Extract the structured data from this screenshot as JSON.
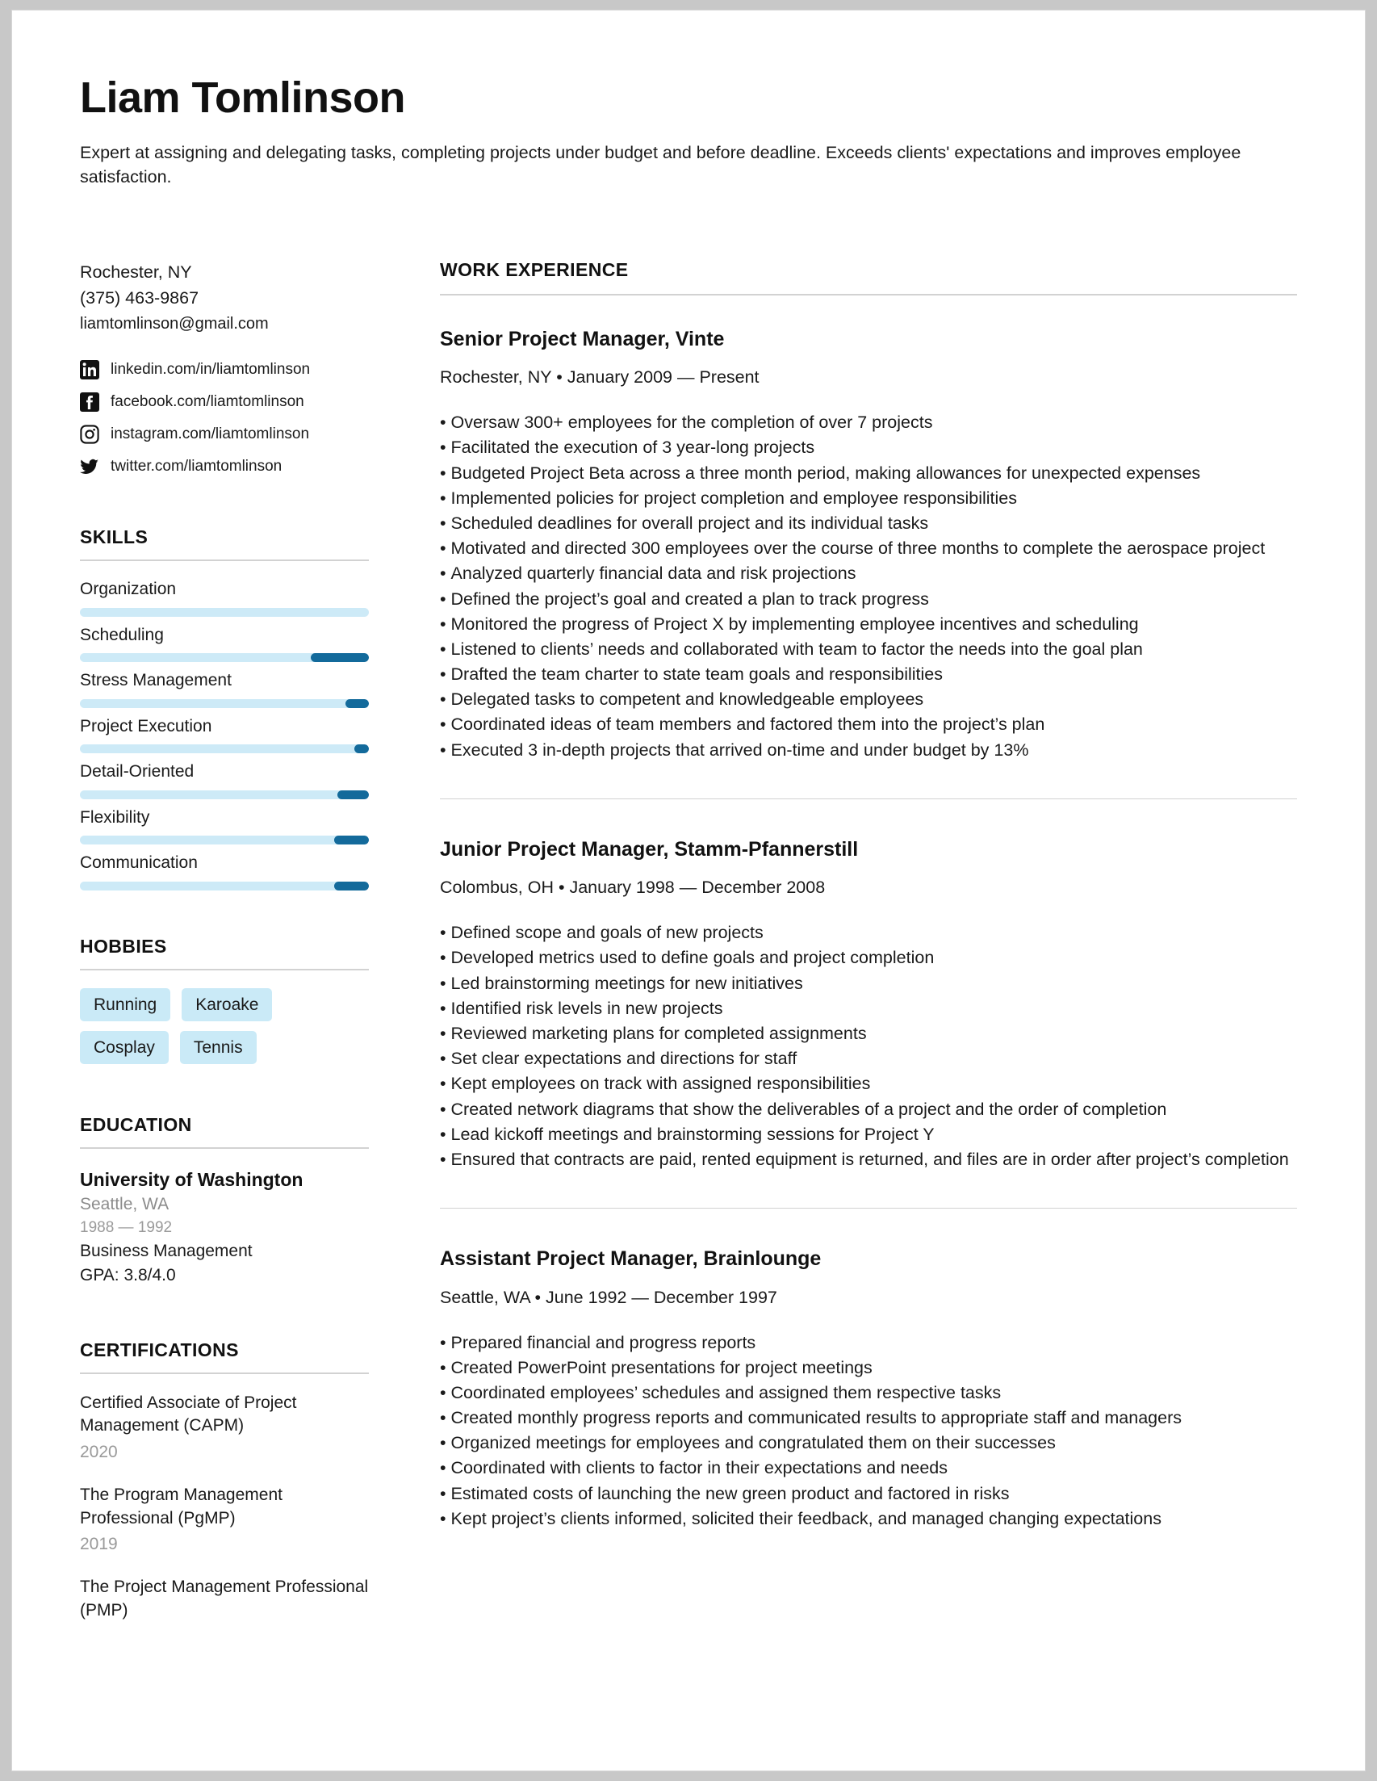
{
  "header": {
    "name": "Liam Tomlinson",
    "summary": "Expert at assigning and delegating tasks, completing projects under budget and before deadline. Exceeds clients' expectations and improves employee satisfaction."
  },
  "colors": {
    "skill_track": "#cdeaf7",
    "skill_fill": "#136a9b",
    "hobby_chip": "#caeaf7",
    "rule": "#d2d2d2",
    "muted_text": "#9a9a9a"
  },
  "contact": {
    "location": "Rochester, NY",
    "phone": "(375) 463-9867",
    "email": "liamtomlinson@gmail.com",
    "socials": [
      {
        "icon": "linkedin-icon",
        "text": "linkedin.com/in/liamtomlinson"
      },
      {
        "icon": "facebook-icon",
        "text": "facebook.com/liamtomlinson"
      },
      {
        "icon": "instagram-icon",
        "text": "instagram.com/liamtomlinson"
      },
      {
        "icon": "twitter-icon",
        "text": "twitter.com/liamtomlinson"
      }
    ]
  },
  "skills": {
    "title": "SKILLS",
    "items": [
      {
        "label": "Organization",
        "fill_percent": 0
      },
      {
        "label": "Scheduling",
        "fill_percent": 20
      },
      {
        "label": "Stress Management",
        "fill_percent": 8
      },
      {
        "label": "Project Execution",
        "fill_percent": 5
      },
      {
        "label": "Detail-Oriented",
        "fill_percent": 11
      },
      {
        "label": "Flexibility",
        "fill_percent": 12
      },
      {
        "label": "Communication",
        "fill_percent": 12
      }
    ]
  },
  "hobbies": {
    "title": "HOBBIES",
    "items": [
      "Running",
      "Karoake",
      "Cosplay",
      "Tennis"
    ]
  },
  "education": {
    "title": "EDUCATION",
    "school": "University of Washington",
    "location": "Seattle, WA",
    "years": "1988 — 1992",
    "major": "Business Management",
    "gpa": "GPA: 3.8/4.0"
  },
  "certifications": {
    "title": "CERTIFICATIONS",
    "items": [
      {
        "name": "Certified Associate of Project Management (CAPM)",
        "year": "2020"
      },
      {
        "name": "The Program Management Professional (PgMP)",
        "year": "2019"
      },
      {
        "name": "The Project Management Professional (PMP)",
        "year": ""
      }
    ]
  },
  "work": {
    "title": "WORK EXPERIENCE",
    "jobs": [
      {
        "title": "Senior Project Manager, Vinte",
        "meta": "Rochester, NY • January 2009 — Present",
        "bullets": [
          "Oversaw 300+ employees for the completion of over 7 projects",
          "Facilitated the execution of 3 year-long projects",
          "Budgeted Project Beta across a three month period, making allowances for unexpected expenses",
          "Implemented policies for project completion and employee responsibilities",
          "Scheduled deadlines for overall project and its individual tasks",
          "Motivated and directed 300 employees over the course of three months to complete the aerospace project",
          "Analyzed quarterly financial data and risk projections",
          "Defined the project’s goal and created a plan to track progress",
          "Monitored the progress of Project X by implementing employee incentives and scheduling",
          "Listened to clients’ needs and collaborated with team to factor the needs into the goal plan",
          "Drafted the team charter to state team goals and responsibilities",
          "Delegated tasks to competent and knowledgeable employees",
          "Coordinated ideas of team members and factored them into the project’s plan",
          "Executed 3 in-depth projects that arrived on-time and under budget by 13%"
        ]
      },
      {
        "title": "Junior Project Manager, Stamm-Pfannerstill",
        "meta": "Colombus, OH • January 1998 — December 2008",
        "bullets": [
          "Defined scope and goals of new projects",
          "Developed metrics used to define goals and project completion",
          "Led brainstorming meetings for new initiatives",
          "Identified risk levels in new projects",
          "Reviewed marketing plans for completed assignments",
          "Set clear expectations and directions for staff",
          "Kept employees on track with assigned responsibilities",
          "Created network diagrams that show the deliverables of a project and the order of completion",
          "Lead kickoff meetings and brainstorming sessions for Project Y",
          "Ensured that contracts are paid, rented equipment is returned, and files are in order after project’s completion"
        ]
      },
      {
        "title": "Assistant Project Manager, Brainlounge",
        "meta": "Seattle, WA • June 1992 — December 1997",
        "bullets": [
          "Prepared financial and progress reports",
          "Created PowerPoint presentations for project meetings",
          "Coordinated employees’ schedules and assigned them respective tasks",
          "Created monthly progress reports and communicated results to appropriate staff and managers",
          "Organized meetings for employees and congratulated them on their successes",
          "Coordinated with clients to factor in their expectations and needs",
          "Estimated costs of launching the new green product and factored in risks",
          "Kept project’s clients informed, solicited their feedback, and managed changing expectations"
        ]
      }
    ]
  }
}
